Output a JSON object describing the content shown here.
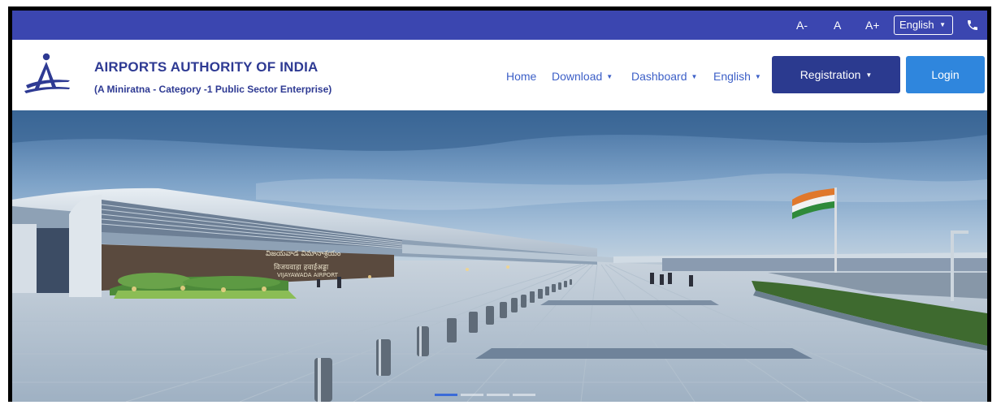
{
  "topbar": {
    "font_decrease": "A-",
    "font_normal": "A",
    "font_increase": "A+",
    "language_selected": "English",
    "phone_icon": "phone-icon",
    "color": "#3b46b0"
  },
  "header": {
    "org_name": "AIRPORTS AUTHORITY OF INDIA",
    "org_subtitle": "(A Miniratna - Category -1 Public Sector Enterprise)",
    "logo_icon": "aai-logo-icon",
    "brand_color": "#2e3a93"
  },
  "nav": {
    "home": "Home",
    "download": "Download",
    "dashboard": "Dashboard",
    "language": "English",
    "registration": "Registration",
    "login": "Login",
    "link_color": "#3c5fc7",
    "registration_color": "#2b3a8f",
    "login_color": "#2f86dd"
  },
  "hero": {
    "sign_line1": "విజయవాడ విమానాశ్రయం",
    "sign_line2": "विजयवाड़ा हवाईअड्डा",
    "sign_line3": "VIJAYAWADA AIRPORT"
  },
  "carousel": {
    "active_slide": 1,
    "slide_count": 4
  }
}
